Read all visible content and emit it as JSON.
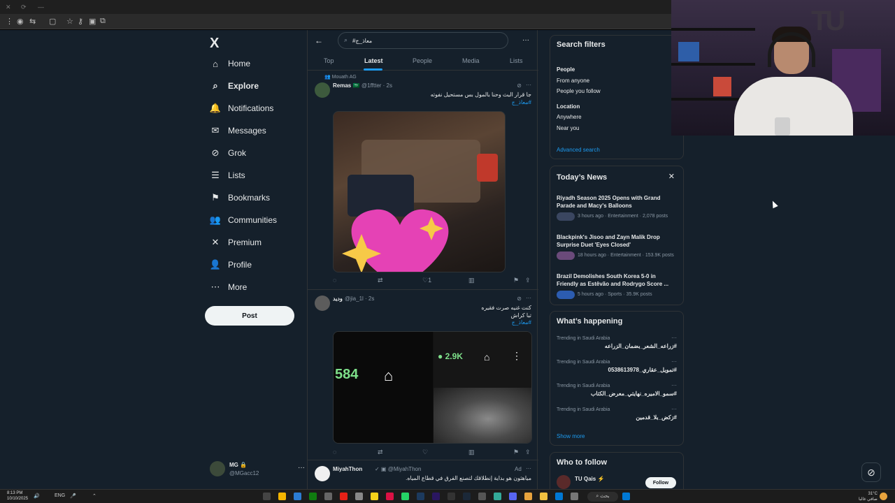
{
  "browser": {
    "dots": [
      "✕",
      "⟳",
      "—"
    ]
  },
  "nav": {
    "logo": "X",
    "items": [
      {
        "label": "Home",
        "icon": "home-icon",
        "glyph": "⌂"
      },
      {
        "label": "Explore",
        "icon": "search-icon",
        "glyph": "⌕",
        "bold": true
      },
      {
        "label": "Notifications",
        "icon": "bell-icon",
        "glyph": "🔔"
      },
      {
        "label": "Messages",
        "icon": "mail-icon",
        "glyph": "✉"
      },
      {
        "label": "Grok",
        "icon": "grok-icon",
        "glyph": "⊘"
      },
      {
        "label": "Lists",
        "icon": "list-icon",
        "glyph": "☰"
      },
      {
        "label": "Bookmarks",
        "icon": "bookmark-icon",
        "glyph": "⚑"
      },
      {
        "label": "Communities",
        "icon": "people-icon",
        "glyph": "👥"
      },
      {
        "label": "Premium",
        "icon": "x-icon",
        "glyph": "✕"
      },
      {
        "label": "Profile",
        "icon": "person-icon",
        "glyph": "👤"
      },
      {
        "label": "More",
        "icon": "more-circle-icon",
        "glyph": "⋯"
      }
    ],
    "post_label": "Post",
    "account": {
      "name": "MG 🔒",
      "handle": "@MGacc12",
      "more": "···"
    }
  },
  "main": {
    "search_value": "#معاذ_ج",
    "more": "···",
    "tabs": [
      "Top",
      "Latest",
      "People",
      "Media",
      "Lists"
    ],
    "tweets": [
      {
        "social": "Mouath AG",
        "name": "Remas 🇸🇦",
        "handle": "@1fftter · 2s",
        "text": "جا قرار البث وحنا بالمول بس مستحيل نفوته",
        "tag": "#معاذ_ج",
        "likes": "1"
      },
      {
        "name": "وديد",
        "handle": "@jia_1l · 2s",
        "text_lines": [
          "كنت غنيه صرت فقيره",
          "تبا كراش"
        ],
        "tag": "#معاذ_ج",
        "media_left": "584",
        "media_right": "2.9K"
      },
      {
        "name": "MiyahThon",
        "handle": "@MiyahThon",
        "ad": "Ad",
        "text": "مياهثون هو بداية إنطلاقك لتصنع الفرق في قطاع المياه."
      }
    ]
  },
  "right": {
    "filters": {
      "title": "Search filters",
      "people_label": "People",
      "people_opts": [
        "From anyone",
        "People you follow"
      ],
      "location_label": "Location",
      "location_opts": [
        "Anywhere",
        "Near you"
      ],
      "advanced": "Advanced search"
    },
    "news": {
      "title": "Today’s News",
      "items": [
        {
          "title": "Riyadh Season 2025 Opens with Grand Parade and Macy's Balloons",
          "meta": "3 hours ago · Entertainment · 2,078 posts"
        },
        {
          "title": "Blackpink's Jisoo and Zayn Malik Drop Surprise Duet 'Eyes Closed'",
          "meta": "18 hours ago · Entertainment · 153.9K posts"
        },
        {
          "title": "Brazil Demolishes South Korea 5-0 in Friendly as Estêvão and Rodrygo Score ...",
          "meta": "5 hours ago · Sports · 35.9K posts"
        }
      ]
    },
    "happening": {
      "title": "What’s happening",
      "trends": [
        {
          "ctx": "Trending in Saudi Arabia",
          "name": "#زراعه_الشعر_بضمان_الزراعه"
        },
        {
          "ctx": "Trending in Saudi Arabia",
          "name": "#تمويل_عقاري_0538613978"
        },
        {
          "ctx": "Trending in Saudi Arabia",
          "name": "#سمو_الاميره_نهايتي_معرض_الكتاب"
        },
        {
          "ctx": "Trending in Saudi Arabia",
          "name": "#زكض_بلا_قدمين"
        }
      ],
      "show_more": "Show more"
    },
    "follow": {
      "title": "Who to follow",
      "name": "TU Qais ⚡",
      "button": "Follow"
    }
  },
  "taskbar": {
    "time": "8:13 PM",
    "date": "10/10/2025",
    "lang": "ENG",
    "search": "بحث",
    "weather_temp": "31°C",
    "weather_desc": "صافي غالبا"
  }
}
